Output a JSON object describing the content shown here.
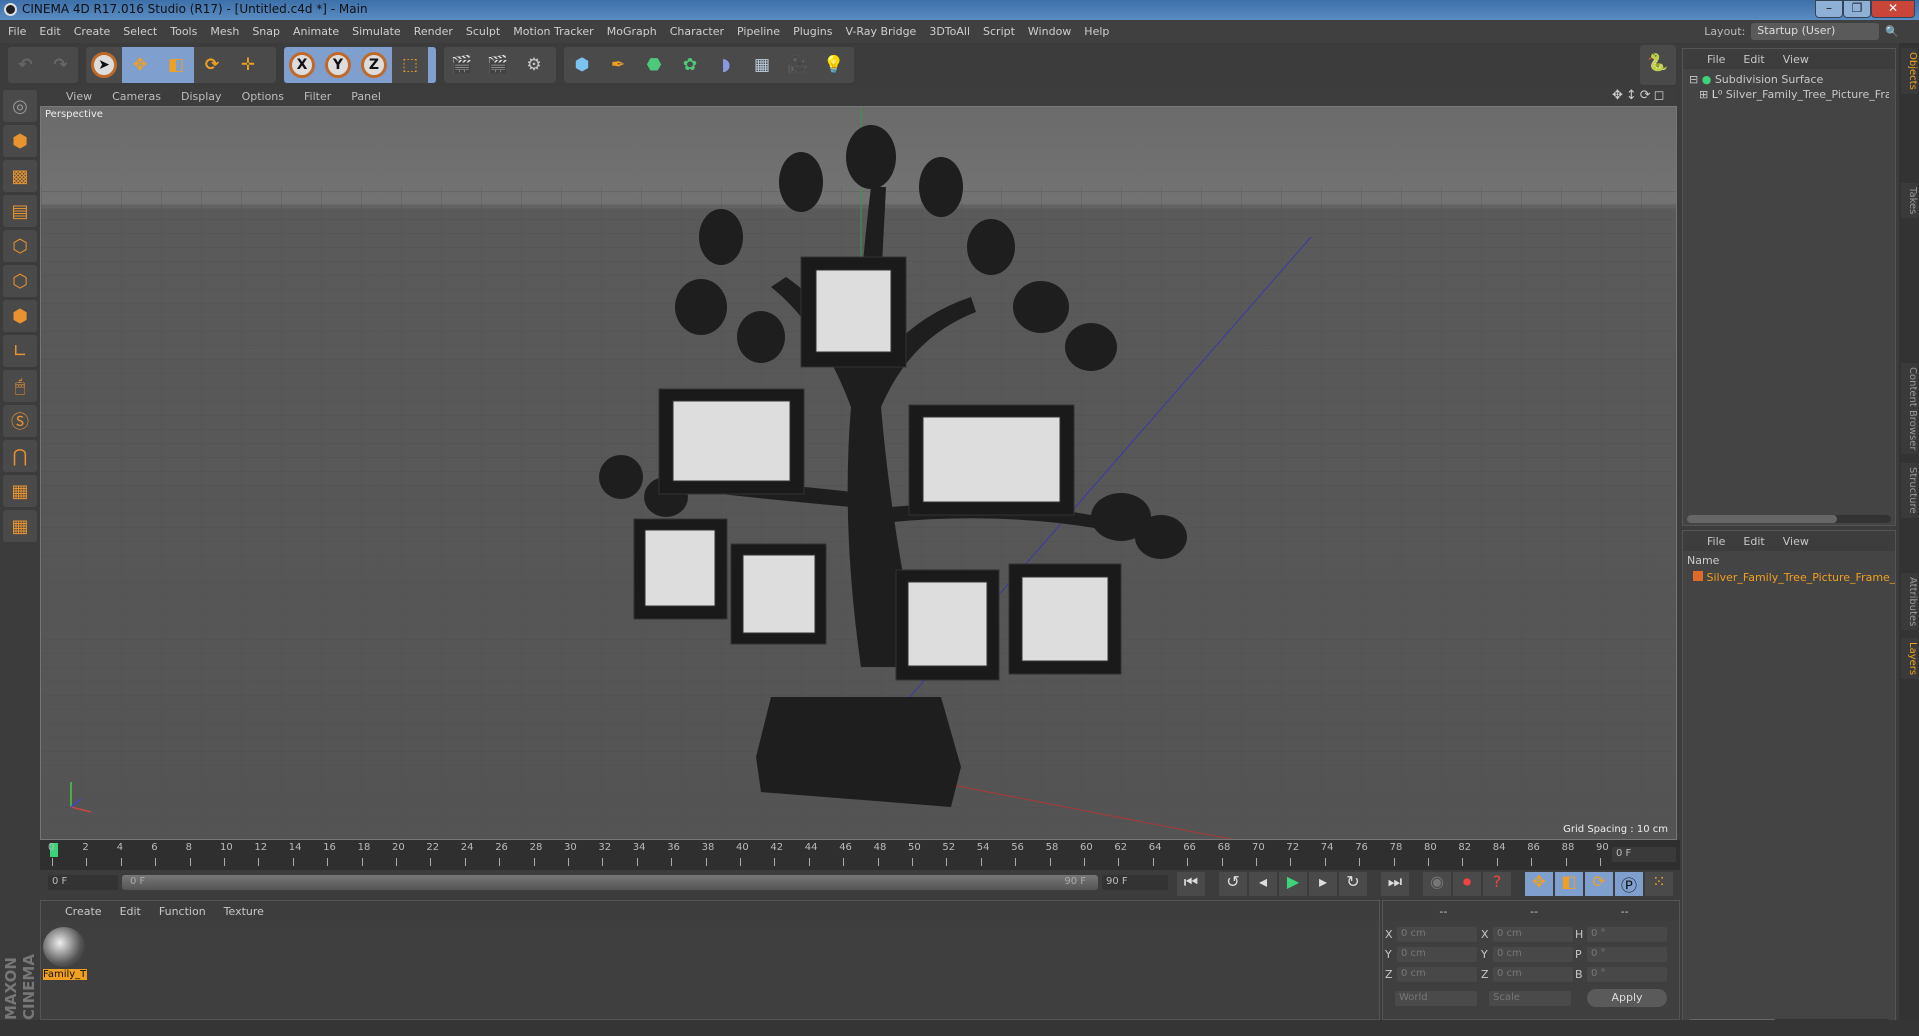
{
  "window": {
    "title": "CINEMA 4D R17.016 Studio (R17) - [Untitled.c4d *] - Main",
    "controls": [
      "minimize",
      "restore",
      "close"
    ]
  },
  "menu": [
    "File",
    "Edit",
    "Create",
    "Select",
    "Tools",
    "Mesh",
    "Snap",
    "Animate",
    "Simulate",
    "Render",
    "Sculpt",
    "Motion Tracker",
    "MoGraph",
    "Character",
    "Pipeline",
    "Plugins",
    "V-Ray Bridge",
    "3DToAll",
    "Script",
    "Window",
    "Help"
  ],
  "layout": {
    "label": "Layout:",
    "value": "Startup (User)"
  },
  "toolbar": {
    "axis": [
      "X",
      "Y",
      "Z"
    ]
  },
  "viewport": {
    "menu": [
      "View",
      "Cameras",
      "Display",
      "Options",
      "Filter",
      "Panel"
    ],
    "camera_label": "Perspective",
    "grid_spacing": "Grid Spacing : 10 cm"
  },
  "timeline": {
    "ticks": [
      0,
      2,
      4,
      6,
      8,
      10,
      12,
      14,
      16,
      18,
      20,
      22,
      24,
      26,
      28,
      30,
      32,
      34,
      36,
      38,
      40,
      42,
      44,
      46,
      48,
      50,
      52,
      54,
      56,
      58,
      60,
      62,
      64,
      66,
      68,
      70,
      72,
      74,
      76,
      78,
      80,
      82,
      84,
      86,
      88,
      90
    ],
    "current_frame": "0 F",
    "start_field": "0 F",
    "range_start": "0 F",
    "range_end": "90 F",
    "end_field": "90 F"
  },
  "materials": {
    "menu": [
      "Create",
      "Edit",
      "Function",
      "Texture"
    ],
    "items": [
      {
        "name": "Family_T"
      }
    ]
  },
  "coords": {
    "headers": [
      "--",
      "--",
      "--"
    ],
    "rows": [
      {
        "a": "X",
        "av": "0 cm",
        "b": "X",
        "bv": "0 cm",
        "c": "H",
        "cv": "0 °"
      },
      {
        "a": "Y",
        "av": "0 cm",
        "b": "Y",
        "bv": "0 cm",
        "c": "P",
        "cv": "0 °"
      },
      {
        "a": "Z",
        "av": "0 cm",
        "b": "Z",
        "bv": "0 cm",
        "c": "B",
        "cv": "0 °"
      }
    ],
    "mode": "World",
    "type": "Scale",
    "apply": "Apply"
  },
  "objects": {
    "menu": [
      "File",
      "Edit",
      "View"
    ],
    "items": [
      {
        "name": "Subdivision Surface"
      },
      {
        "name": "Silver_Family_Tree_Picture_Frame"
      }
    ]
  },
  "layers": {
    "menu": [
      "File",
      "Edit",
      "View"
    ],
    "column": "Name",
    "items": [
      {
        "name": "Silver_Family_Tree_Picture_Frame_C",
        "color": "#e06a2a"
      }
    ]
  },
  "side_tabs": [
    "Objects",
    "Takes",
    "Content Browser",
    "Structure",
    "Attributes",
    "Layers"
  ],
  "brand": {
    "logo_text": "MAXON CINEMA 4D"
  },
  "colors": {
    "accent": "#f0a020",
    "selection": "#7f9fcf"
  }
}
